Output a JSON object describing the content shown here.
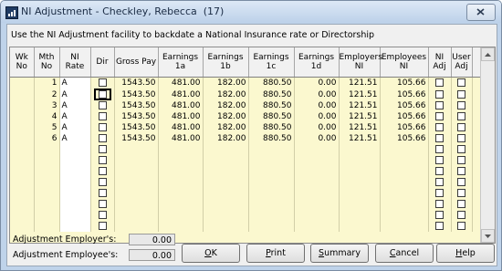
{
  "window": {
    "title": "NI Adjustment - Checkley, Rebecca",
    "employee_id": "(17)"
  },
  "instruction": "Use the NI Adjustment facility to backdate a National Insurance rate or Directorship",
  "columns": [
    {
      "l1": "Wk",
      "l2": "No"
    },
    {
      "l1": "Mth",
      "l2": "No"
    },
    {
      "l1": "NI",
      "l2": "Rate"
    },
    {
      "l1": "Dir",
      "l2": ""
    },
    {
      "l1": "Gross Pay",
      "l2": ""
    },
    {
      "l1": "Earnings",
      "l2": "1a"
    },
    {
      "l1": "Earnings",
      "l2": "1b"
    },
    {
      "l1": "Earnings",
      "l2": "1c"
    },
    {
      "l1": "Earnings",
      "l2": "1d"
    },
    {
      "l1": "Employers",
      "l2": "NI"
    },
    {
      "l1": "Employees",
      "l2": "NI"
    },
    {
      "l1": "NI",
      "l2": "Adj"
    },
    {
      "l1": "User",
      "l2": "Adj"
    }
  ],
  "rows": [
    {
      "wk": "",
      "mth": "1",
      "rate": "A",
      "gross": "1543.50",
      "e1a": "481.00",
      "e1b": "182.00",
      "e1c": "880.50",
      "e1d": "0.00",
      "er_ni": "121.51",
      "ee_ni": "105.66"
    },
    {
      "wk": "",
      "mth": "2",
      "rate": "A",
      "gross": "1543.50",
      "e1a": "481.00",
      "e1b": "182.00",
      "e1c": "880.50",
      "e1d": "0.00",
      "er_ni": "121.51",
      "ee_ni": "105.66"
    },
    {
      "wk": "",
      "mth": "3",
      "rate": "A",
      "gross": "1543.50",
      "e1a": "481.00",
      "e1b": "182.00",
      "e1c": "880.50",
      "e1d": "0.00",
      "er_ni": "121.51",
      "ee_ni": "105.66"
    },
    {
      "wk": "",
      "mth": "4",
      "rate": "A",
      "gross": "1543.50",
      "e1a": "481.00",
      "e1b": "182.00",
      "e1c": "880.50",
      "e1d": "0.00",
      "er_ni": "121.51",
      "ee_ni": "105.66"
    },
    {
      "wk": "",
      "mth": "5",
      "rate": "A",
      "gross": "1543.50",
      "e1a": "481.00",
      "e1b": "182.00",
      "e1c": "880.50",
      "e1d": "0.00",
      "er_ni": "121.51",
      "ee_ni": "105.66"
    },
    {
      "wk": "",
      "mth": "6",
      "rate": "A",
      "gross": "1543.50",
      "e1a": "481.00",
      "e1b": "182.00",
      "e1c": "880.50",
      "e1d": "0.00",
      "er_ni": "121.51",
      "ee_ni": "105.66"
    },
    {
      "wk": "",
      "mth": "",
      "rate": "",
      "gross": "",
      "e1a": "",
      "e1b": "",
      "e1c": "",
      "e1d": "",
      "er_ni": "",
      "ee_ni": ""
    },
    {
      "wk": "",
      "mth": "",
      "rate": "",
      "gross": "",
      "e1a": "",
      "e1b": "",
      "e1c": "",
      "e1d": "",
      "er_ni": "",
      "ee_ni": ""
    },
    {
      "wk": "",
      "mth": "",
      "rate": "",
      "gross": "",
      "e1a": "",
      "e1b": "",
      "e1c": "",
      "e1d": "",
      "er_ni": "",
      "ee_ni": ""
    },
    {
      "wk": "",
      "mth": "",
      "rate": "",
      "gross": "",
      "e1a": "",
      "e1b": "",
      "e1c": "",
      "e1d": "",
      "er_ni": "",
      "ee_ni": ""
    },
    {
      "wk": "",
      "mth": "",
      "rate": "",
      "gross": "",
      "e1a": "",
      "e1b": "",
      "e1c": "",
      "e1d": "",
      "er_ni": "",
      "ee_ni": ""
    },
    {
      "wk": "",
      "mth": "",
      "rate": "",
      "gross": "",
      "e1a": "",
      "e1b": "",
      "e1c": "",
      "e1d": "",
      "er_ni": "",
      "ee_ni": ""
    },
    {
      "wk": "",
      "mth": "",
      "rate": "",
      "gross": "",
      "e1a": "",
      "e1b": "",
      "e1c": "",
      "e1d": "",
      "er_ni": "",
      "ee_ni": ""
    },
    {
      "wk": "",
      "mth": "",
      "rate": "",
      "gross": "",
      "e1a": "",
      "e1b": "",
      "e1c": "",
      "e1d": "",
      "er_ni": "",
      "ee_ni": ""
    }
  ],
  "summary": {
    "employer_label": "Adjustment Employer's:",
    "employer_value": "0.00",
    "employee_label": "Adjustment Employee's:",
    "employee_value": "0.00"
  },
  "buttons": {
    "ok_key": "O",
    "ok_rest": "K",
    "print_key": "P",
    "print_rest": "rint",
    "summary_key": "S",
    "summary_rest": "ummary",
    "cancel_key": "C",
    "cancel_rest": "ancel",
    "help_key": "H",
    "help_rest": "elp"
  },
  "icons": {
    "app": "payroll-app-icon",
    "close": "close-icon",
    "scroll_up": "scroll-up-arrow-icon",
    "scroll_down": "scroll-down-arrow-icon"
  }
}
